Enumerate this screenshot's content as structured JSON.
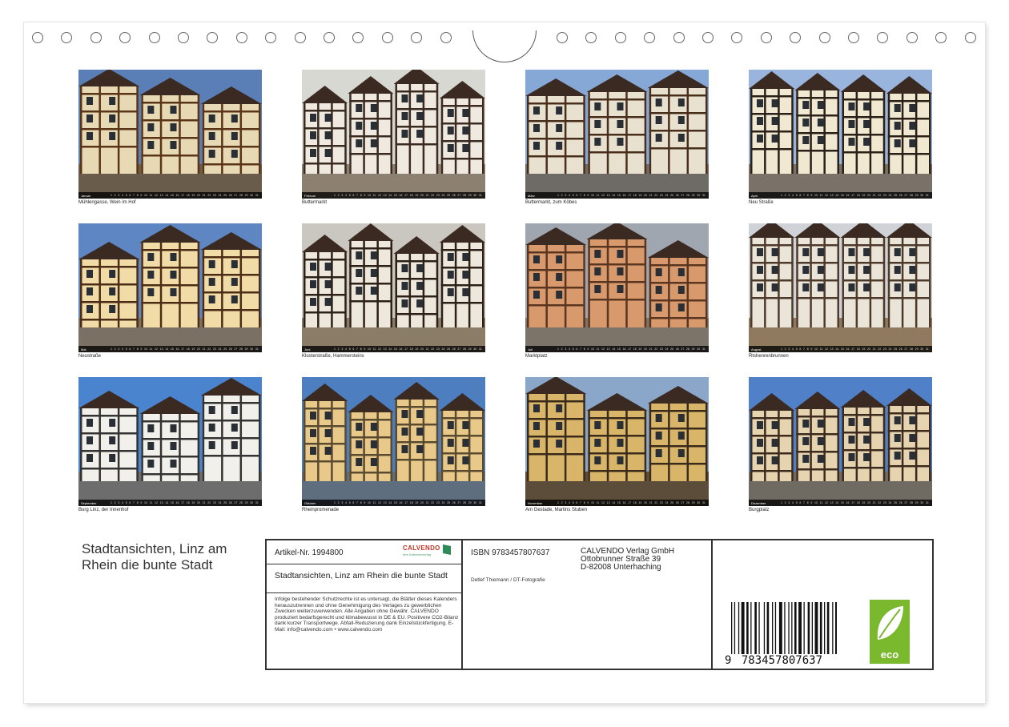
{
  "photos": [
    {
      "caption": "Mühlengasse, Wein im Hof",
      "month": "Januar",
      "sky": "#5a7fb6",
      "wall": "#e6d9b4",
      "timber": "#5a3416",
      "ground": "#6a5c4a"
    },
    {
      "caption": "Buttermarkt",
      "month": "Februar",
      "sky": "#d8d8d2",
      "wall": "#efe9df",
      "timber": "#3a2a20",
      "ground": "#8c8070"
    },
    {
      "caption": "Buttermarkt, zum Köbes",
      "month": "März",
      "sky": "#86a8d6",
      "wall": "#e9e1cf",
      "timber": "#4a2e1c",
      "ground": "#6e6a66"
    },
    {
      "caption": "Neu Straße",
      "month": "April",
      "sky": "#9ab5dd",
      "wall": "#f0e8d0",
      "timber": "#2a2018",
      "ground": "#7a7268"
    },
    {
      "caption": "Neustraße",
      "month": "Mai",
      "sky": "#5d86c3",
      "wall": "#f1dca8",
      "timber": "#4c2c14",
      "ground": "#7b7064"
    },
    {
      "caption": "Klosterstraße, Hammersteins",
      "month": "Juni",
      "sky": "#c9c7c0",
      "wall": "#ede7dc",
      "timber": "#2d2017",
      "ground": "#8a7c66"
    },
    {
      "caption": "Marktplatz",
      "month": "Juli",
      "sky": "#a0a6b0",
      "wall": "#d89a6c",
      "timber": "#5a3520",
      "ground": "#7c7468"
    },
    {
      "caption": "Rtshenrenbrunnen",
      "month": "August",
      "sky": "#cfd2d6",
      "wall": "#ebe4d8",
      "timber": "#4e3a2a",
      "ground": "#8f7a60"
    },
    {
      "caption": "Burg Linz, der Innenhof",
      "month": "September",
      "sky": "#4a84cf",
      "wall": "#f2f0ea",
      "timber": "#333333",
      "ground": "#6d6d6d"
    },
    {
      "caption": "Rheinpromenade",
      "month": "Oktober",
      "sky": "#4d7fc0",
      "wall": "#e8c98a",
      "timber": "#5a4a30",
      "ground": "#5f6e7e"
    },
    {
      "caption": "Am Gestade, Martins Stuben",
      "month": "November",
      "sky": "#8aa6c8",
      "wall": "#d9b56a",
      "timber": "#3a2a1a",
      "ground": "#5b4d3a"
    },
    {
      "caption": "Burgplatz",
      "month": "Dezember",
      "sky": "#4f80c8",
      "wall": "#e6d3b0",
      "timber": "#3c2a1c",
      "ground": "#6f6a62"
    }
  ],
  "calendar_title": "Stadtansichten, Linz am Rhein die bunte Stadt",
  "info": {
    "article": "Artikel-Nr. 1994800",
    "brand": "CALVENDO",
    "brand_tagline": "Ihre Kalenderverlag",
    "product_title": "Stadtansichten, Linz am Rhein die bunte Stadt",
    "legal_text": "Infolge bestehender Schutzrechte ist es untersagt, die Blätter dieses Kalenders herauszutrennen und ohne Genehmigung des Verlages zu gewerblichen Zwecken weiterzuverwenden. Alle Angaben ohne Gewähr. CALVENDO produziert bedarfsgerecht und klimabewusst in DE & EU. Positivere CO2-Bilanz dank kurzer Transportwege. Abfall-Reduzierung dank Einzelstückfertigung. E-Mail: info@calvendo.com • www.calvendo.com",
    "isbn": "ISBN 9783457807637",
    "author": "Detlef Thiemann / DT-Fotografie",
    "publisher_name": "CALVENDO Verlag GmbH",
    "publisher_street": "Ottobrunner Straße 39",
    "publisher_city": "D-82008 Unterhaching",
    "barcode_digits": [
      "9",
      "783457",
      "807637"
    ],
    "eco_label": "eco",
    "brand_color": "#c03a2b",
    "eco_color": "#7ab82e"
  }
}
